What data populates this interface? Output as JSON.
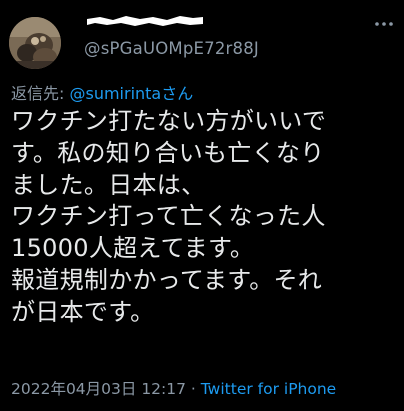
{
  "author": {
    "display_name": "",
    "handle": "@sPGaUOMpE72r88J"
  },
  "reply": {
    "label": "返信先: ",
    "user": "@sumirinta",
    "suffix": "さん"
  },
  "tweet": {
    "lines": [
      "ワクチン打たない方がいいで",
      "す。私の知り合いも亡くなり",
      "ました。日本は、",
      "ワクチン打って亡くなった人",
      "15000人超えてます。",
      "報道規制かかってます。それ",
      "が日本です。"
    ]
  },
  "meta": {
    "timestamp": "2022年04月03日 12:17",
    "separator": " · ",
    "source": "Twitter for iPhone"
  },
  "icons": {
    "more": "more-horizontal-icon",
    "avatar": "avatar-image"
  },
  "colors": {
    "background": "#000000",
    "text": "#e7e9ea",
    "secondary": "#8b98a5",
    "accent": "#1d9bf0"
  }
}
